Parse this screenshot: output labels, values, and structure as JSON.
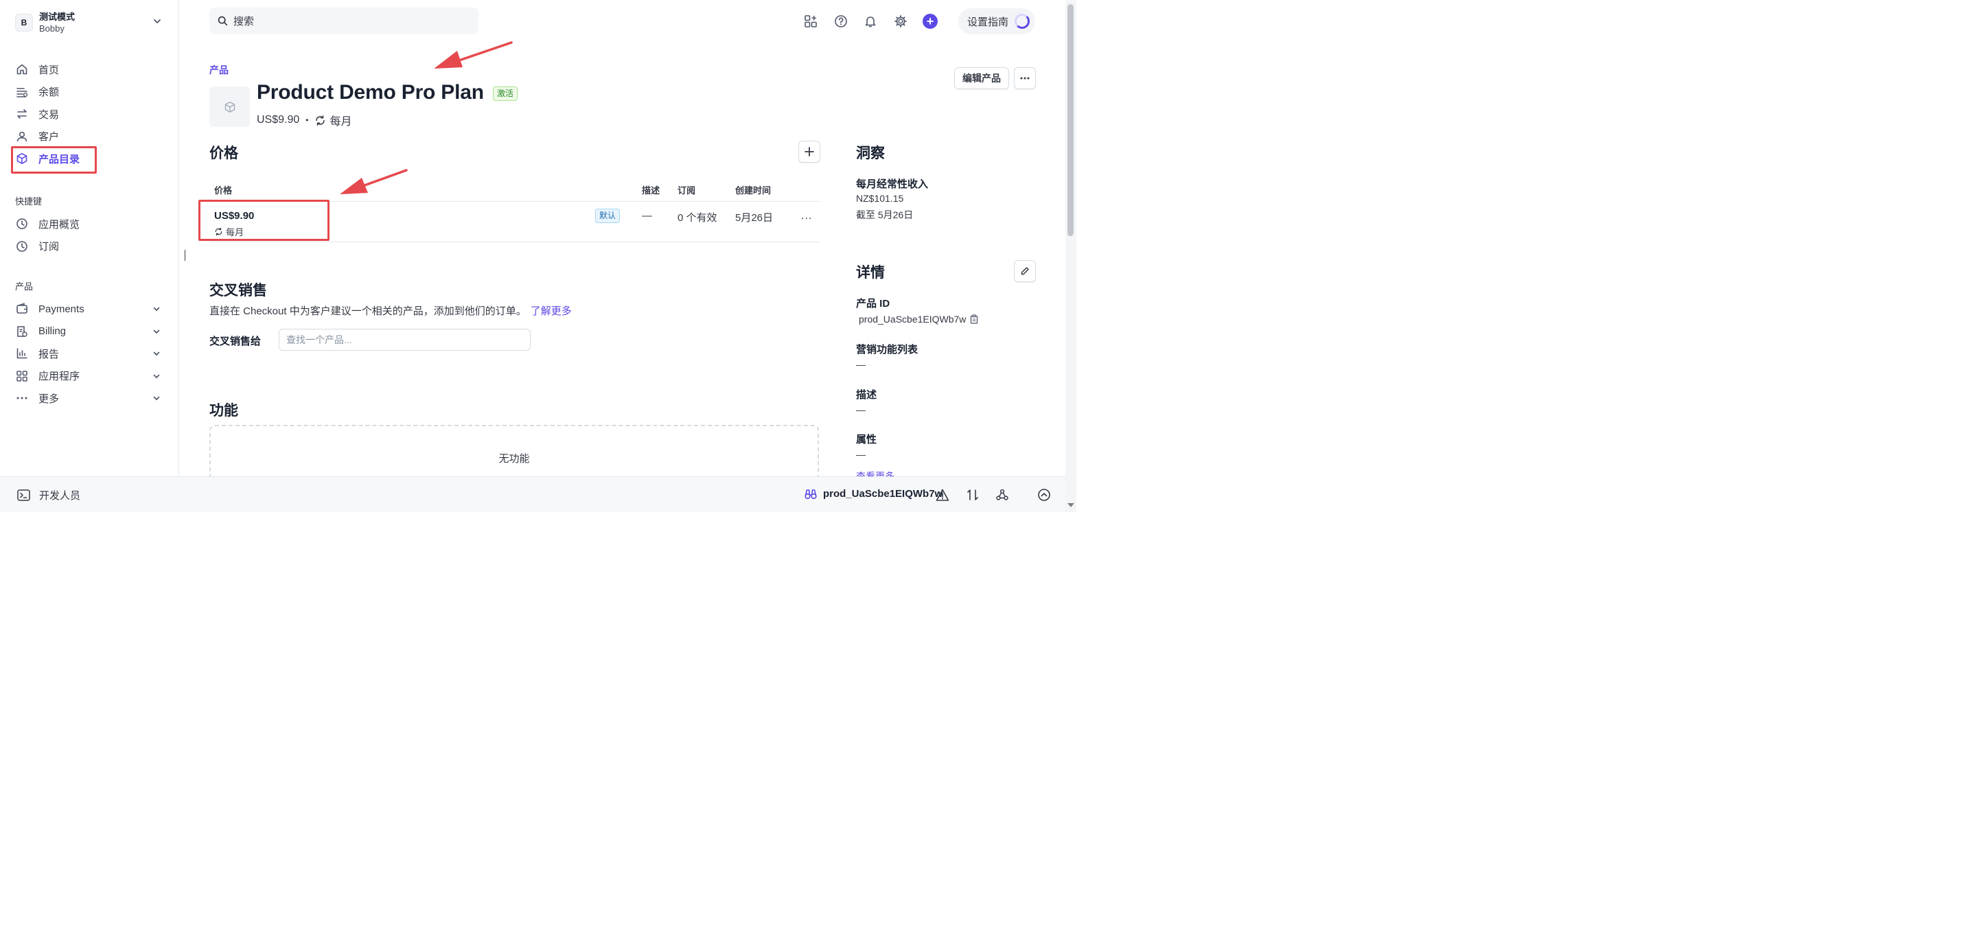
{
  "colors": {
    "accent": "#5b4ae6",
    "annotation_red": "#e5484d",
    "active_green": "#2a8a2a",
    "default_blue": "#1f6fb0"
  },
  "account": {
    "avatar_letter": "B",
    "mode": "测试模式",
    "user": "Bobby"
  },
  "sidebar": {
    "main_items": [
      {
        "label": "首页",
        "icon": "home-icon"
      },
      {
        "label": "余额",
        "icon": "balance-icon"
      },
      {
        "label": "交易",
        "icon": "transactions-icon"
      },
      {
        "label": "客户",
        "icon": "customer-icon"
      },
      {
        "label": "产品目录",
        "icon": "product-catalog-icon",
        "active": true
      }
    ],
    "shortcuts_label": "快捷键",
    "shortcuts": [
      {
        "label": "应用概览",
        "icon": "clock-icon"
      },
      {
        "label": "订阅",
        "icon": "clock-icon"
      }
    ],
    "products_label": "产品",
    "products": [
      {
        "label": "Payments",
        "icon": "wallet-icon"
      },
      {
        "label": "Billing",
        "icon": "billing-icon"
      },
      {
        "label": "报告",
        "icon": "bar-chart-icon"
      },
      {
        "label": "应用程序",
        "icon": "apps-icon"
      },
      {
        "label": "更多",
        "icon": "more-icon"
      }
    ]
  },
  "topbar": {
    "search_placeholder": "搜索",
    "plus_symbol": "+",
    "guide_label": "设置指南"
  },
  "header": {
    "breadcrumb": "产品",
    "title": "Product Demo Pro Plan",
    "status_badge": "激活",
    "price": "US$9.90",
    "separator": "•",
    "interval": "每月",
    "edit_button": "编辑产品"
  },
  "pricing": {
    "heading": "价格",
    "columns": [
      "价格",
      "描述",
      "订阅",
      "创建时间"
    ],
    "rows": [
      {
        "price": "US$9.90",
        "interval": "每月",
        "badge": "默认",
        "description": "—",
        "subscriptions": "0 个有效",
        "created": "5月26日",
        "menu": "..."
      }
    ]
  },
  "cross_sell": {
    "heading": "交叉销售",
    "description": "直接在 Checkout 中为客户建议一个相关的产品，添加到他们的订单。",
    "learn_more": "了解更多",
    "field_label": "交叉销售给",
    "field_placeholder": "查找一个产品..."
  },
  "features": {
    "heading": "功能",
    "empty_text": "无功能"
  },
  "insights": {
    "heading": "洞察",
    "mrr_label": "每月经常性收入",
    "mrr_value": "NZ$101.15",
    "as_of": "截至 5月26日"
  },
  "details": {
    "heading": "详情",
    "product_id_label": "产品 ID",
    "product_id": "prod_UaScbe1EIQWb7w",
    "marketing_label": "营销功能列表",
    "marketing_value": "—",
    "description_label": "描述",
    "description_value": "—",
    "attributes_label": "属性",
    "attributes_value": "—",
    "see_more": "查看更多"
  },
  "footer": {
    "developer_label": "开发人员",
    "object_id": "prod_UaScbe1EIQWb7w"
  }
}
